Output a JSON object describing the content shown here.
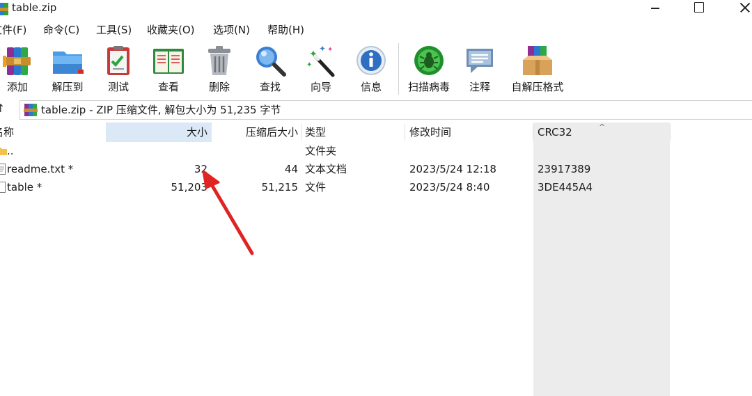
{
  "window": {
    "title": "table.zip"
  },
  "menu": [
    {
      "label": "文件(F)"
    },
    {
      "label": "命令(C)"
    },
    {
      "label": "工具(S)"
    },
    {
      "label": "收藏夹(O)"
    },
    {
      "label": "选项(N)"
    },
    {
      "label": "帮助(H)"
    }
  ],
  "toolbar": [
    {
      "label": "添加",
      "icon": "add-archive-icon"
    },
    {
      "label": "解压到",
      "icon": "extract-folder-icon"
    },
    {
      "label": "测试",
      "icon": "test-clipboard-icon"
    },
    {
      "label": "查看",
      "icon": "view-book-icon"
    },
    {
      "label": "删除",
      "icon": "trash-can-icon"
    },
    {
      "label": "查找",
      "icon": "magnifier-icon"
    },
    {
      "label": "向导",
      "icon": "wizard-wand-icon"
    },
    {
      "label": "信息",
      "icon": "info-icon"
    },
    {
      "label": "扫描病毒",
      "icon": "virus-bug-icon"
    },
    {
      "label": "注释",
      "icon": "comment-icon"
    },
    {
      "label": "自解压格式",
      "icon": "sfx-box-icon"
    }
  ],
  "address": {
    "text": "table.zip - ZIP 压缩文件, 解包大小为 51,235 字节"
  },
  "columns": {
    "name": "名称",
    "size": "大小",
    "packed": "压缩后大小",
    "type": "类型",
    "modified": "修改时间",
    "crc": "CRC32"
  },
  "rows": [
    {
      "name": "..",
      "size": "",
      "packed": "",
      "type": "文件夹",
      "modified": "",
      "crc": ""
    },
    {
      "name": "readme.txt *",
      "size": "32",
      "packed": "44",
      "type": "文本文档",
      "modified": "2023/5/24 12:18",
      "crc": "23917389"
    },
    {
      "name": "table *",
      "size": "51,203",
      "packed": "51,215",
      "type": "文件",
      "modified": "2023/5/24 8:40",
      "crc": "3DE445A4"
    }
  ],
  "colors": {
    "accent_arrow": "#e02424",
    "size_header_bg": "#dbe8f5",
    "crc_column_bg": "#ececec"
  }
}
